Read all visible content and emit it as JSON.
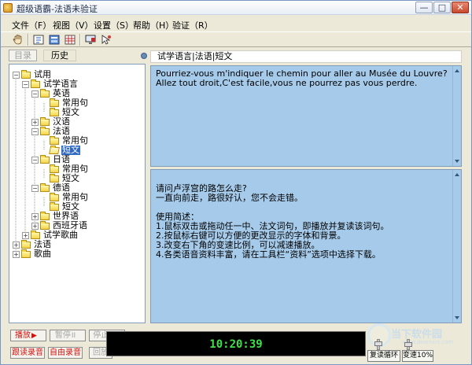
{
  "window": {
    "title": "超级语霸-法语未验证",
    "minimize_label": "—",
    "maximize_label": "□",
    "close_label": "✕"
  },
  "menu": [
    {
      "label": "文件（F）"
    },
    {
      "label": "视图（V）"
    },
    {
      "label": "设置（S）"
    },
    {
      "label": "帮助（H）"
    },
    {
      "label": "验证（R）"
    }
  ],
  "toolbar_icons": [
    "hand-icon",
    "dictionary-icon",
    "book-icon",
    "grid-icon",
    "monitor-icon",
    "pointer-icon"
  ],
  "left_tabs": {
    "catalog": "目录",
    "history": "历史"
  },
  "tree": [
    {
      "label": "试用",
      "level": 0,
      "expander": "−",
      "open": false
    },
    {
      "label": "试学语言",
      "level": 1,
      "expander": "−",
      "open": false
    },
    {
      "label": "英语",
      "level": 2,
      "expander": "−",
      "open": false
    },
    {
      "label": "常用句",
      "level": 3,
      "expander": "",
      "open": false
    },
    {
      "label": "短文",
      "level": 3,
      "expander": "",
      "open": false
    },
    {
      "label": "汉语",
      "level": 2,
      "expander": "+",
      "open": false
    },
    {
      "label": "法语",
      "level": 2,
      "expander": "−",
      "open": false
    },
    {
      "label": "常用句",
      "level": 3,
      "expander": "",
      "open": false
    },
    {
      "label": "短文",
      "level": 3,
      "expander": "",
      "open": true,
      "selected": true
    },
    {
      "label": "日语",
      "level": 2,
      "expander": "−",
      "open": false
    },
    {
      "label": "常用句",
      "level": 3,
      "expander": "",
      "open": false
    },
    {
      "label": "短文",
      "level": 3,
      "expander": "",
      "open": false
    },
    {
      "label": "德语",
      "level": 2,
      "expander": "−",
      "open": false
    },
    {
      "label": "常用句",
      "level": 3,
      "expander": "",
      "open": false
    },
    {
      "label": "短文",
      "level": 3,
      "expander": "",
      "open": false
    },
    {
      "label": "世界语",
      "level": 2,
      "expander": "+",
      "open": false
    },
    {
      "label": "西班牙语",
      "level": 2,
      "expander": "+",
      "open": false
    },
    {
      "label": "试学歌曲",
      "level": 1,
      "expander": "+",
      "open": false
    },
    {
      "label": "法语",
      "level": 0,
      "expander": "+",
      "open": false
    },
    {
      "label": "歌曲",
      "level": 0,
      "expander": "+",
      "open": false
    }
  ],
  "breadcrumb": "试学语言|法语|短文",
  "top_text": [
    "Pourriez-vous m'indiquer le chemin pour aller au Musée du Louvre?",
    "Allez tout droit,C'est facile,vous ne pourrez pas vous perdre."
  ],
  "bottom_text": [
    "请问卢浮宫的路怎么走?",
    "一直向前走，路很好认，您不会走错。",
    "",
    "使用简述：",
    "1.鼠标双击或拖动任一中、法文词句，即播放并复读该词句。",
    "2.按鼠标右键可以方便的更改显示的字体和背景。",
    "3.改变右下角的变速比例，可以减速播放。",
    "4.各类语音资料丰富，请在工具栏“资料”选项中选择下载。"
  ],
  "controls": {
    "play": "播放",
    "pause": "暂停",
    "stop": "停止",
    "follow_record": "跟读录音",
    "free_record": "自由录音",
    "playback": "回放"
  },
  "clock": "10:20:39",
  "repeat_mode": "复读循环",
  "speed": "变速10%",
  "watermark": {
    "text": "当下软件园",
    "sub": "www.downxia.com"
  }
}
